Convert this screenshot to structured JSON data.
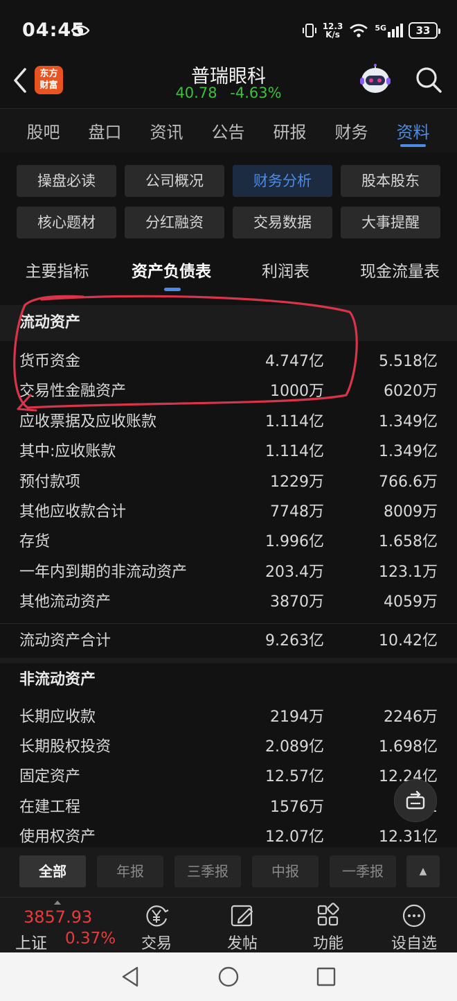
{
  "status_bar": {
    "time": "04:45",
    "net_speed_top": "12.3",
    "net_speed_bottom": "K/s",
    "signal": "5G",
    "battery": "33"
  },
  "header": {
    "logo_line1": "东方",
    "logo_line2": "财富",
    "stock_name": "普瑞眼科",
    "price": "40.78",
    "change_pct": "-4.63%"
  },
  "main_tabs": [
    {
      "label": "股吧"
    },
    {
      "label": "盘口"
    },
    {
      "label": "资讯"
    },
    {
      "label": "公告"
    },
    {
      "label": "研报"
    },
    {
      "label": "财务"
    },
    {
      "label": "资料"
    }
  ],
  "section_buttons": [
    {
      "label": "操盘必读"
    },
    {
      "label": "公司概况"
    },
    {
      "label": "财务分析"
    },
    {
      "label": "股本股东"
    },
    {
      "label": "核心题材"
    },
    {
      "label": "分红融资"
    },
    {
      "label": "交易数据"
    },
    {
      "label": "大事提醒"
    }
  ],
  "statement_tabs": [
    {
      "label": "主要指标"
    },
    {
      "label": "资产负债表"
    },
    {
      "label": "利润表"
    },
    {
      "label": "现金流量表"
    }
  ],
  "current_assets": {
    "title": "流动资产",
    "rows": [
      {
        "label": "货币资金",
        "v1": "4.747亿",
        "v2": "5.518亿"
      },
      {
        "label": "交易性金融资产",
        "v1": "1000万",
        "v2": "6020万"
      },
      {
        "label": "应收票据及应收账款",
        "v1": "1.114亿",
        "v2": "1.349亿"
      },
      {
        "label": "其中:应收账款",
        "v1": "1.114亿",
        "v2": "1.349亿"
      },
      {
        "label": "预付款项",
        "v1": "1229万",
        "v2": "766.6万"
      },
      {
        "label": "其他应收款合计",
        "v1": "7748万",
        "v2": "8009万"
      },
      {
        "label": "存货",
        "v1": "1.996亿",
        "v2": "1.658亿"
      },
      {
        "label": "一年内到期的非流动资产",
        "v1": "203.4万",
        "v2": "123.1万"
      },
      {
        "label": "其他流动资产",
        "v1": "3870万",
        "v2": "4059万"
      }
    ],
    "total": {
      "label": "流动资产合计",
      "v1": "9.263亿",
      "v2": "10.42亿"
    }
  },
  "noncurrent_assets": {
    "title": "非流动资产",
    "rows": [
      {
        "label": "长期应收款",
        "v1": "2194万",
        "v2": "2246万"
      },
      {
        "label": "长期股权投资",
        "v1": "2.089亿",
        "v2": "1.698亿"
      },
      {
        "label": "固定资产",
        "v1": "12.57亿",
        "v2": "12.24亿"
      },
      {
        "label": "在建工程",
        "v1": "1576万",
        "v2": "1"
      },
      {
        "label": "使用权资产",
        "v1": "12.07亿",
        "v2": "12.31亿"
      }
    ]
  },
  "period_filter": [
    {
      "label": "全部"
    },
    {
      "label": "年报"
    },
    {
      "label": "三季报"
    },
    {
      "label": "中报"
    },
    {
      "label": "一季报"
    }
  ],
  "scroll_top_label": "▲",
  "bottom_nav": {
    "index_value": "3857.93",
    "index_name": "上证",
    "index_change": "0.37%",
    "items": [
      {
        "label": "交易",
        "icon": "yen-trade-icon"
      },
      {
        "label": "发帖",
        "icon": "compose-icon"
      },
      {
        "label": "功能",
        "icon": "apps-grid-icon"
      },
      {
        "label": "设自选",
        "icon": "more-dots-icon"
      }
    ]
  },
  "colors": {
    "background": "#121212",
    "accent_blue": "#4c8ce6",
    "down_green": "#3fbf3f",
    "up_red": "#e83b3b",
    "annotation_red": "#d8344a",
    "logo_orange": "#e8531f"
  }
}
